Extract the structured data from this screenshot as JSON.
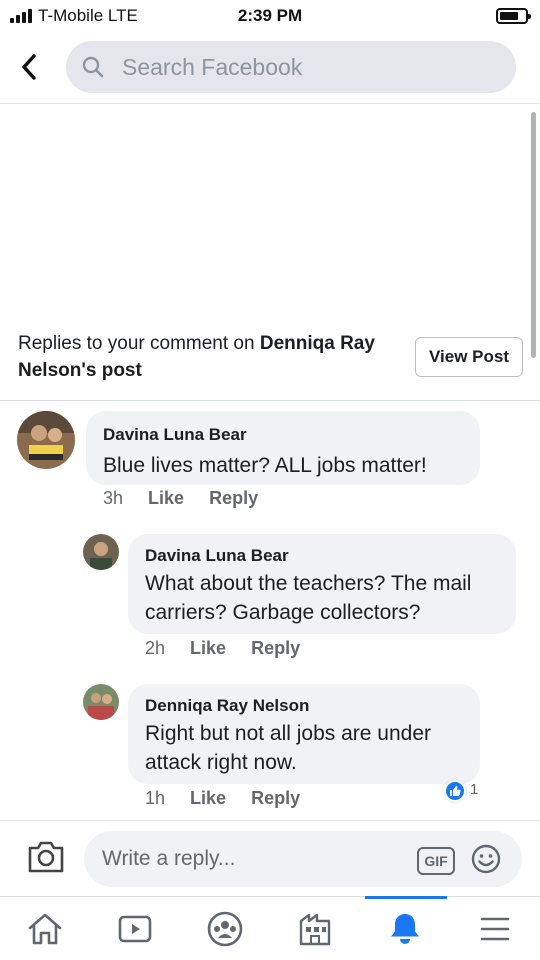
{
  "status_bar": {
    "carrier": "T-Mobile  LTE",
    "time": "2:39 PM"
  },
  "search": {
    "placeholder": "Search Facebook"
  },
  "context": {
    "prefix": "Replies to your comment on ",
    "author": "Denniqa Ray Nelson",
    "suffix": "'s post",
    "view_post_label": "View Post"
  },
  "comments": [
    {
      "name": "Davina Luna Bear",
      "text": "Blue lives matter? ALL jobs matter!",
      "time": "3h",
      "like": "Like",
      "reply": "Reply"
    },
    {
      "name": "Davina Luna Bear",
      "text": "What about the teachers? The mail carriers? Garbage collectors?",
      "time": "2h",
      "like": "Like",
      "reply": "Reply"
    },
    {
      "name": "Denniqa Ray Nelson",
      "text": "Right but not all jobs are under attack right now.",
      "time": "1h",
      "like": "Like",
      "reply": "Reply",
      "reaction_count": "1"
    }
  ],
  "composer": {
    "placeholder": "Write a reply...",
    "gif_label": "GIF"
  },
  "nav": {
    "items": [
      "home-icon",
      "watch-icon",
      "groups-icon",
      "marketplace-icon",
      "notifications-icon",
      "menu-icon"
    ],
    "active": "notifications-icon"
  },
  "colors": {
    "accent": "#1877f2",
    "bubble": "#f0f2f5",
    "muted": "#65676b"
  }
}
